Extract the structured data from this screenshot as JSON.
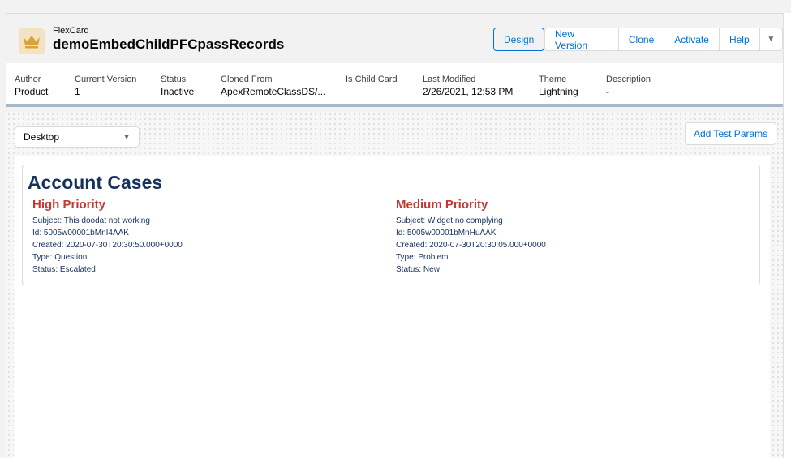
{
  "header": {
    "card_type": "FlexCard",
    "card_name": "demoEmbedChildPFCpassRecords",
    "buttons": {
      "design": "Design",
      "new_version": "New Version",
      "clone": "Clone",
      "activate": "Activate",
      "help": "Help",
      "more": "▼"
    }
  },
  "info": {
    "author": {
      "label": "Author",
      "value": "Product"
    },
    "current_version": {
      "label": "Current Version",
      "value": "1"
    },
    "status": {
      "label": "Status",
      "value": "Inactive"
    },
    "cloned_from": {
      "label": "Cloned From",
      "value": "ApexRemoteClassDS/..."
    },
    "is_child_card": {
      "label": "Is Child Card",
      "value": ""
    },
    "last_modified": {
      "label": "Last Modified",
      "value": "2/26/2021, 12:53 PM"
    },
    "theme": {
      "label": "Theme",
      "value": "Lightning"
    },
    "description": {
      "label": "Description",
      "value": "-"
    }
  },
  "toolbar": {
    "device_select": "Desktop",
    "device_chevron": "▼",
    "add_test_params": "Add Test Params"
  },
  "card": {
    "title": "Account Cases",
    "cases": [
      {
        "heading": "High Priority",
        "subject": "Subject: This doodat not working",
        "id": "Id: 5005w00001bMnI4AAK",
        "created": "Created: 2020-07-30T20:30:50.000+0000",
        "type": "Type: Question",
        "status": "Status: Escalated"
      },
      {
        "heading": "Medium Priority",
        "subject": "Subject: Widget no complying",
        "id": "Id: 5005w00001bMnHuAAK",
        "created": "Created: 2020-07-30T20:30:05.000+0000",
        "type": "Type: Problem",
        "status": "Status: New"
      }
    ]
  },
  "colors": {
    "accent": "#0070d2",
    "title": "#16325c",
    "priority": "#c23934",
    "icon_bg": "#f4e3c3",
    "icon": "#d9a33b"
  },
  "icons": {
    "brand": "crown-icon"
  }
}
